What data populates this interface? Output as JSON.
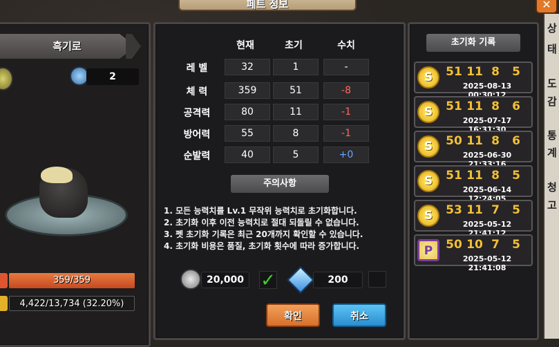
{
  "window": {
    "title": "페트 정보"
  },
  "pet": {
    "name": "흑기로",
    "count": "2",
    "hp": "359/359",
    "exp": "4,422/13,734 (32.20%)"
  },
  "stats": {
    "headers": [
      "현재",
      "초기",
      "수치"
    ],
    "rows": [
      {
        "label": "레 벨",
        "current": "32",
        "initial": "1",
        "diff": "-",
        "diff_type": "neutral"
      },
      {
        "label": "체 력",
        "current": "359",
        "initial": "51",
        "diff": "-8",
        "diff_type": "neg"
      },
      {
        "label": "공격력",
        "current": "80",
        "initial": "11",
        "diff": "-1",
        "diff_type": "neg"
      },
      {
        "label": "방어력",
        "current": "55",
        "initial": "8",
        "diff": "-1",
        "diff_type": "neg"
      },
      {
        "label": "순발력",
        "current": "40",
        "initial": "5",
        "diff": "+0",
        "diff_type": "pos"
      }
    ]
  },
  "notice": {
    "title": "주의사항",
    "items": [
      "1. 모든 능력치를 Lv.1 무작위 능력치로 초기화합니다.",
      "2. 초기화 이후 이전 능력치로 절대 되돌릴 수 없습니다.",
      "3. 펫 초기화 기록은 최근 20개까지 확인할 수 있습니다.",
      "4. 초기화 비용은 품질, 초기화 횟수에 따라 증가합니다."
    ]
  },
  "cost": {
    "coin": "20,000",
    "gem": "200"
  },
  "buttons": {
    "confirm": "확인",
    "cancel": "취소"
  },
  "history": {
    "title": "초기화 기록",
    "records": [
      {
        "grade": "S",
        "nums": [
          "51",
          "11",
          "8",
          "5"
        ],
        "date": "2025-08-13 00:30:12",
        "badge": "gold"
      },
      {
        "grade": "S",
        "nums": [
          "51",
          "11",
          "8",
          "6"
        ],
        "date": "2025-07-17 16:31:30",
        "badge": "gold"
      },
      {
        "grade": "S",
        "nums": [
          "50",
          "11",
          "8",
          "6"
        ],
        "date": "2025-06-30 21:33:16",
        "badge": "gold"
      },
      {
        "grade": "S",
        "nums": [
          "51",
          "11",
          "8",
          "5"
        ],
        "date": "2025-06-14 12:24:05",
        "badge": "gold"
      },
      {
        "grade": "S",
        "nums": [
          "53",
          "11",
          "7",
          "5"
        ],
        "date": "2025-05-12 21:41:12",
        "badge": "gold"
      },
      {
        "grade": "P",
        "nums": [
          "50",
          "10",
          "7",
          "5"
        ],
        "date": "2025-05-12 21:41:08",
        "badge": "purple"
      }
    ]
  },
  "side_tabs": [
    "상",
    "태",
    "도",
    "감",
    "통",
    "계",
    "청",
    "고"
  ]
}
